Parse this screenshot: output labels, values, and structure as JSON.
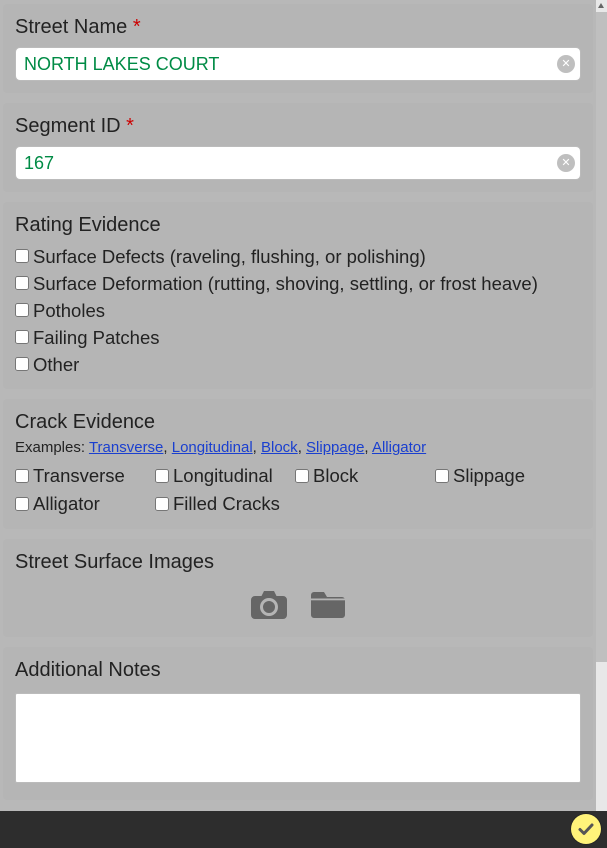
{
  "street_name": {
    "label": "Street Name",
    "value": "NORTH LAKES COURT",
    "required_mark": "*"
  },
  "segment_id": {
    "label": "Segment ID",
    "value": "167",
    "required_mark": "*"
  },
  "rating_evidence": {
    "title": "Rating Evidence",
    "options": [
      "Surface Defects (raveling, flushing, or polishing)",
      "Surface Deformation (rutting, shoving, settling, or frost heave)",
      "Potholes",
      "Failing Patches",
      "Other"
    ]
  },
  "crack_evidence": {
    "title": "Crack Evidence",
    "examples_prefix": "Examples: ",
    "examples": [
      "Transverse",
      "Longitudinal",
      "Block",
      "Slippage",
      "Alligator"
    ],
    "options": [
      "Transverse",
      "Longitudinal",
      "Block",
      "Slippage",
      "Alligator",
      "Filled Cracks"
    ]
  },
  "street_images": {
    "title": "Street Surface Images"
  },
  "notes": {
    "title": "Additional Notes",
    "value": ""
  }
}
